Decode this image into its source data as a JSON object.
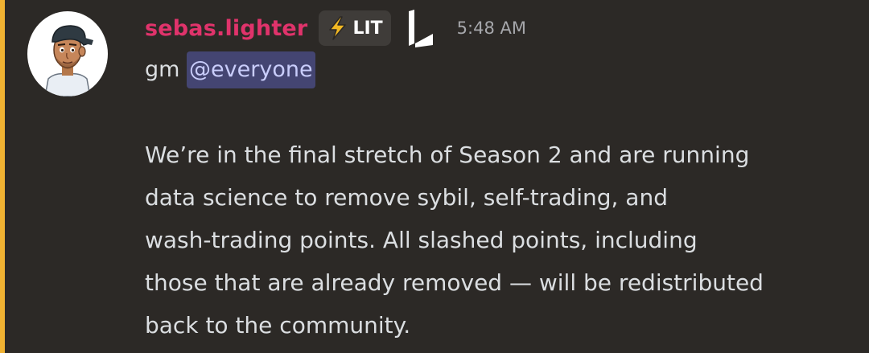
{
  "message": {
    "author": {
      "username": "sebas.lighter",
      "avatar_icon": "cartoon-man-backwards-cap-avatar",
      "name_color": "#e0336b"
    },
    "clan_tag": {
      "icon": "lightning-bolt-icon",
      "label": "LIT"
    },
    "guild_badge_icon": "lighter-logo-icon",
    "timestamp": "5:48 AM",
    "greeting": "gm",
    "mention": "@everyone",
    "body": "We’re in the final stretch of Season 2 and are running\ndata science to remove sybil, self-trading, and\nwash-trading points. All slashed points, including\nthose that are already removed — will be redistributed\nback to the community."
  },
  "colors": {
    "background": "#2c2926",
    "highlight_bar": "#f0b232",
    "mention_bg": "#444572",
    "mention_text": "#c9cdfb",
    "timestamp": "#a6a7ab"
  }
}
